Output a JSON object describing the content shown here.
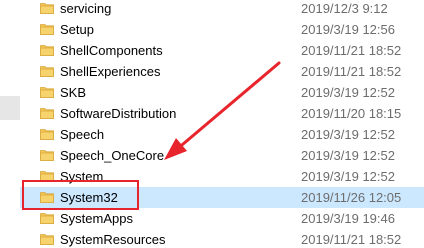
{
  "folder_icon": "folder-icon",
  "colors": {
    "folder": "#f3c65a",
    "selection": "#cce8ff",
    "annotation": "#e8242c"
  },
  "files": [
    {
      "name": "servicing",
      "date": "2019/12/3 9:12"
    },
    {
      "name": "Setup",
      "date": "2019/3/19 12:56"
    },
    {
      "name": "ShellComponents",
      "date": "2019/11/21 18:52"
    },
    {
      "name": "ShellExperiences",
      "date": "2019/11/21 18:52"
    },
    {
      "name": "SKB",
      "date": "2019/3/19 12:52"
    },
    {
      "name": "SoftwareDistribution",
      "date": "2019/11/20 18:15"
    },
    {
      "name": "Speech",
      "date": "2019/3/19 12:52"
    },
    {
      "name": "Speech_OneCore",
      "date": "2019/3/19 12:52"
    },
    {
      "name": "System",
      "date": "2019/3/19 12:52"
    },
    {
      "name": "System32",
      "date": "2019/11/26 12:05",
      "selected": true
    },
    {
      "name": "SystemApps",
      "date": "2019/3/19 19:46"
    },
    {
      "name": "SystemResources",
      "date": "2019/11/21 18:52"
    }
  ],
  "annotation": {
    "highlighted_item": "System32",
    "type": "red-box-with-arrow"
  }
}
